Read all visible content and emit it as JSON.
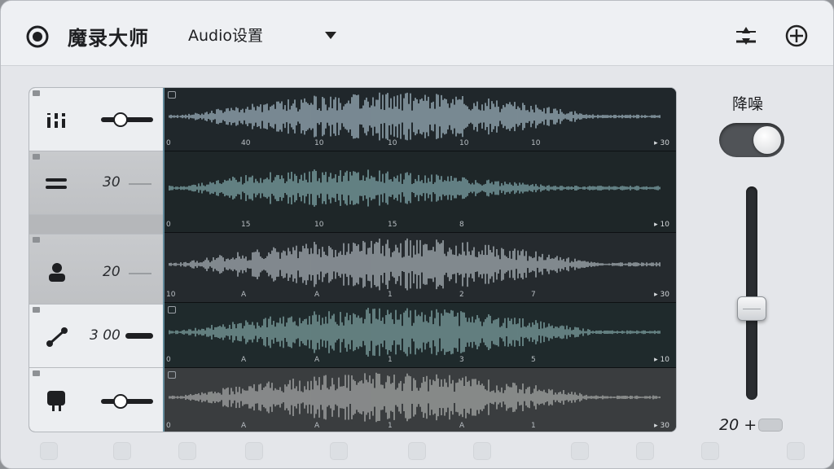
{
  "app": {
    "title": "魔录大师",
    "settings_label": "Audio设置",
    "record_icon": "record-icon",
    "settings_icon": "chevron-down-icon"
  },
  "topbar": {
    "icons": [
      "sliders-icon",
      "crosshair-icon"
    ]
  },
  "tracks": [
    {
      "icon": "equalizer-icon",
      "control": "slider",
      "value": "",
      "slider_level": 0.35,
      "ticks": [
        "0",
        "40",
        "10",
        "10",
        "10",
        "10"
      ],
      "end_label": "▸ 30",
      "color": "#9fb3bf"
    },
    {
      "icon": "menu-lines-icon",
      "control": "value",
      "value": "30",
      "slider_level": null,
      "ticks": [
        "0",
        "15",
        "10",
        "15",
        "8"
      ],
      "end_label": "▸ 10",
      "color": "#7fa6aa"
    },
    {
      "icon": "person-icon",
      "control": "value",
      "value": "20",
      "slider_level": null,
      "ticks": [
        "10",
        "A",
        "A",
        "1",
        "2",
        "7"
      ],
      "end_label": "▸ 30",
      "color": "#a9b2b8"
    },
    {
      "icon": "connect-icon",
      "control": "value",
      "value": "3 00",
      "slider_level": null,
      "ticks": [
        "0",
        "A",
        "A",
        "1",
        "3",
        "5"
      ],
      "end_label": "▸ 10",
      "color": "#7fa3a3"
    },
    {
      "icon": "plug-icon",
      "control": "slider",
      "value": "",
      "slider_level": 0.35,
      "ticks": [
        "0",
        "A",
        "A",
        "1",
        "A",
        "1"
      ],
      "end_label": "▸ 30",
      "color": "#a8aaa9"
    }
  ],
  "noise_reduction": {
    "label": "降噪",
    "enabled": true,
    "level": 0.42,
    "value": "20 +"
  },
  "colors": {
    "accent": "#505357",
    "waveform_bg": "#1d2226",
    "panel": "#e4e6ea"
  }
}
